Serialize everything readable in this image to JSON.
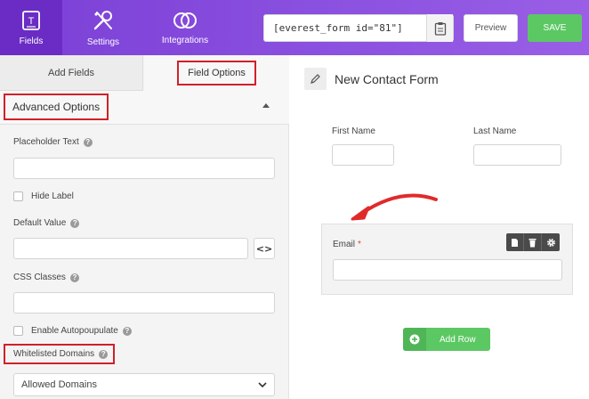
{
  "nav": {
    "fields": "Fields",
    "settings": "Settings",
    "integrations": "Integrations"
  },
  "header": {
    "shortcode": "[everest_form id=\"81\"]",
    "preview": "Preview",
    "save": "SAVE"
  },
  "tabs": {
    "add_fields": "Add Fields",
    "field_options": "Field Options"
  },
  "advanced": {
    "title": "Advanced Options",
    "placeholder_label": "Placeholder Text",
    "hide_label": "Hide Label",
    "default_value_label": "Default Value",
    "code_toggle": "<>",
    "css_classes_label": "CSS Classes",
    "enable_autopopulate": "Enable Autopoupulate",
    "whitelisted_label": "Whitelisted Domains",
    "allowed_domains": "Allowed Domains"
  },
  "form": {
    "title": "New Contact Form",
    "first_name": "First Name",
    "last_name": "Last Name",
    "email": "Email",
    "required_mark": "*",
    "add_row": "Add Row"
  },
  "colors": {
    "header_purple": "#7b3fd6",
    "save_green": "#5cc864",
    "highlight_red": "#d0202a",
    "arrow_red": "#e02a2a"
  }
}
